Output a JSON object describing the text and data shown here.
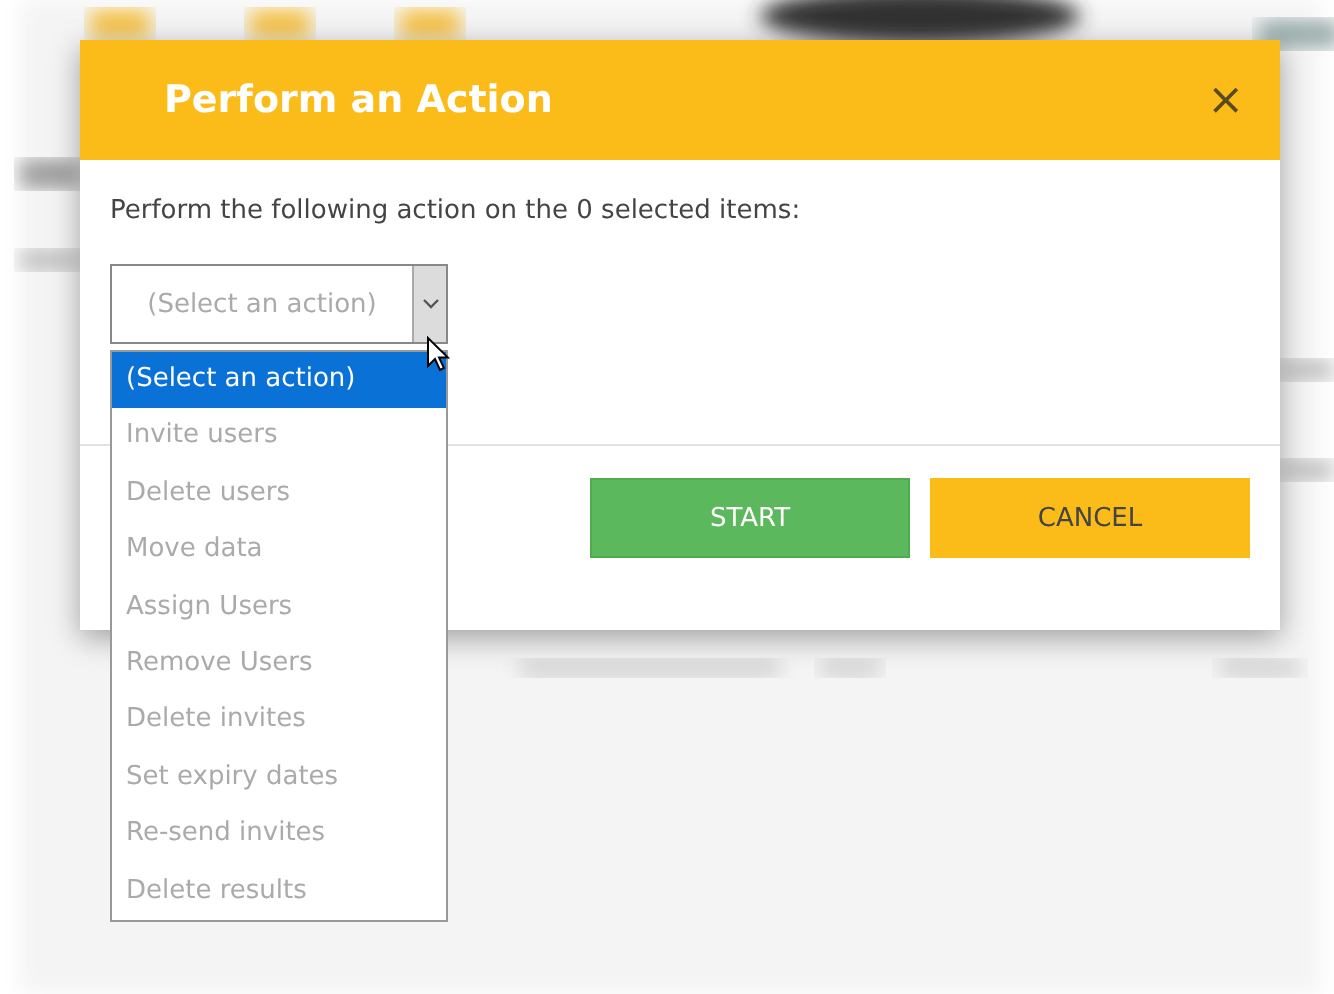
{
  "dialog": {
    "title": "Perform an Action",
    "close": "×",
    "message": "Perform the following action on the 0 selected items:",
    "select": {
      "value": "(Select an action)",
      "expanded": true,
      "options": [
        {
          "label": "(Select an action)",
          "selected": true
        },
        {
          "label": "Invite users",
          "selected": false
        },
        {
          "label": "Delete users",
          "selected": false
        },
        {
          "label": "Move data",
          "selected": false
        },
        {
          "label": "Assign Users",
          "selected": false
        },
        {
          "label": "Remove Users",
          "selected": false
        },
        {
          "label": "Delete invites",
          "selected": false
        },
        {
          "label": "Set expiry dates",
          "selected": false
        },
        {
          "label": "Re-send invites",
          "selected": false
        },
        {
          "label": "Delete results",
          "selected": false
        }
      ]
    },
    "buttons": [
      {
        "label": "START",
        "kind": "primary"
      },
      {
        "label": "CANCEL",
        "kind": "secondary"
      }
    ]
  }
}
